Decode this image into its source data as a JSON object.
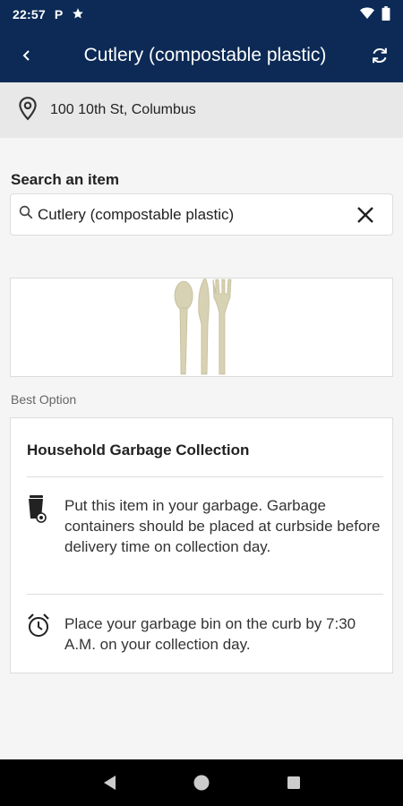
{
  "status_bar": {
    "time": "22:57",
    "notification_letter": "P"
  },
  "app_bar": {
    "title": "Cutlery (compostable plastic)"
  },
  "address": {
    "text": "100 10th St, Columbus"
  },
  "search": {
    "label": "Search an item",
    "value": "Cutlery (compostable plastic)"
  },
  "best_option": {
    "label": "Best Option",
    "title": "Household Garbage Collection",
    "instructions": [
      {
        "icon": "garbage-bin-icon",
        "text": "Put this item in your garbage. Garbage containers should be placed at curbside before delivery time on collection day."
      },
      {
        "icon": "alarm-clock-icon",
        "text": "Place your garbage bin on the curb by 7:30 A.M. on your collection day."
      }
    ]
  },
  "colors": {
    "header_bg": "#0c2a55",
    "address_bg": "#e8e8e8",
    "page_bg": "#f5f5f5",
    "utensil": "#d8d2b4"
  }
}
